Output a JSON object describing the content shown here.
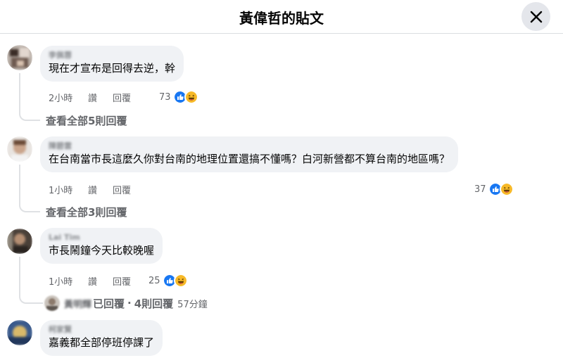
{
  "header": {
    "title": "黃偉哲的貼文"
  },
  "comments": [
    {
      "author": "李佩蓉",
      "text": "現在才宣布是回得去逆，幹",
      "time": "2小時",
      "like_label": "讚",
      "reply_label": "回覆",
      "reaction_count": "73",
      "view_replies": "查看全部5則回覆"
    },
    {
      "author": "陳碧雲",
      "text": "在台南當市長這麼久你對台南的地理位置還搞不懂嗎？白河新營都不算台南的地區嗎？",
      "time": "1小時",
      "like_label": "讚",
      "reply_label": "回覆",
      "reaction_count": "37",
      "view_replies": "查看全部3則回覆"
    },
    {
      "author": "Lai Tim",
      "text": "市長鬧鐘今天比較晚喔",
      "time": "1小時",
      "like_label": "讚",
      "reply_label": "回覆",
      "reaction_count": "25",
      "reply_summary": {
        "name": "黃明輝",
        "action": "已回覆",
        "dot": "·",
        "count": "4則回覆",
        "ago": "57分鐘"
      }
    },
    {
      "author": "柯家賢",
      "text": "嘉義都全部停班停課了"
    }
  ],
  "icons": {
    "close": "close-icon",
    "like": "like-reaction-icon",
    "haha": "haha-reaction-icon"
  },
  "colors": {
    "like_blue": "#1877f2",
    "haha_yellow": "#f7b928",
    "bubble": "#f0f2f5",
    "meta_gray": "#65676b"
  }
}
